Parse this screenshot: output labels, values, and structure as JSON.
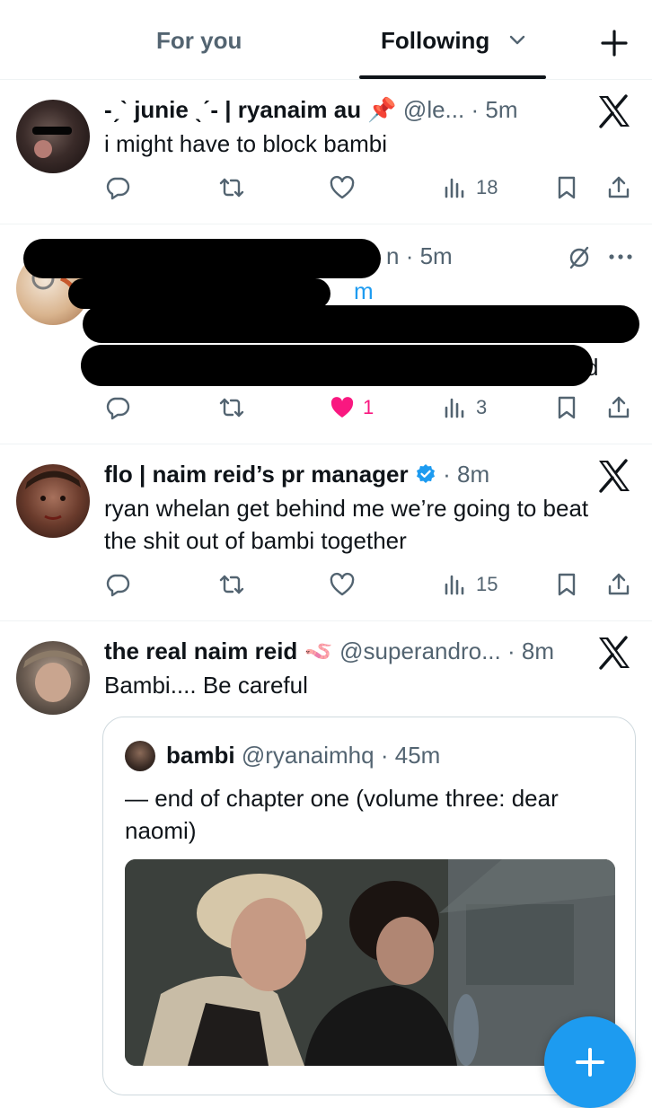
{
  "tabs": {
    "for_you": "For you",
    "following": "Following"
  },
  "colors": {
    "accent": "#1d9bf0",
    "like": "#f91880",
    "text": "#0f1419",
    "secondary": "#536471"
  },
  "tweets": [
    {
      "name": "-ˏˋ junie ˎˊ- | ryanaim au 📌",
      "handle": "@le...",
      "dot": "·",
      "time": "5m",
      "text": "i might have to block bambi",
      "views": "18"
    },
    {
      "handle_fragment": "n",
      "time_prefix": "· 5m",
      "line2_fragment": "m",
      "line4_fragment": "d",
      "likes": "1",
      "views": "3",
      "icons": [
        "mute-icon",
        "more-icon"
      ]
    },
    {
      "name": "flo | naim reid’s pr manager",
      "verified": true,
      "dot": "·",
      "time": "8m",
      "text": "ryan whelan get behind me we’re going to beat the shit out of bambi together",
      "views": "15"
    },
    {
      "name": "the real naim reid 🪱",
      "handle": "@superandro...",
      "dot": "·",
      "time": "8m",
      "text": "Bambi.... Be careful",
      "quote": {
        "name": "bambi",
        "handle": "@ryanaimhq",
        "dot": "·",
        "time": "45m",
        "text": "— end of chapter one (volume three: dear naomi)"
      }
    }
  ]
}
